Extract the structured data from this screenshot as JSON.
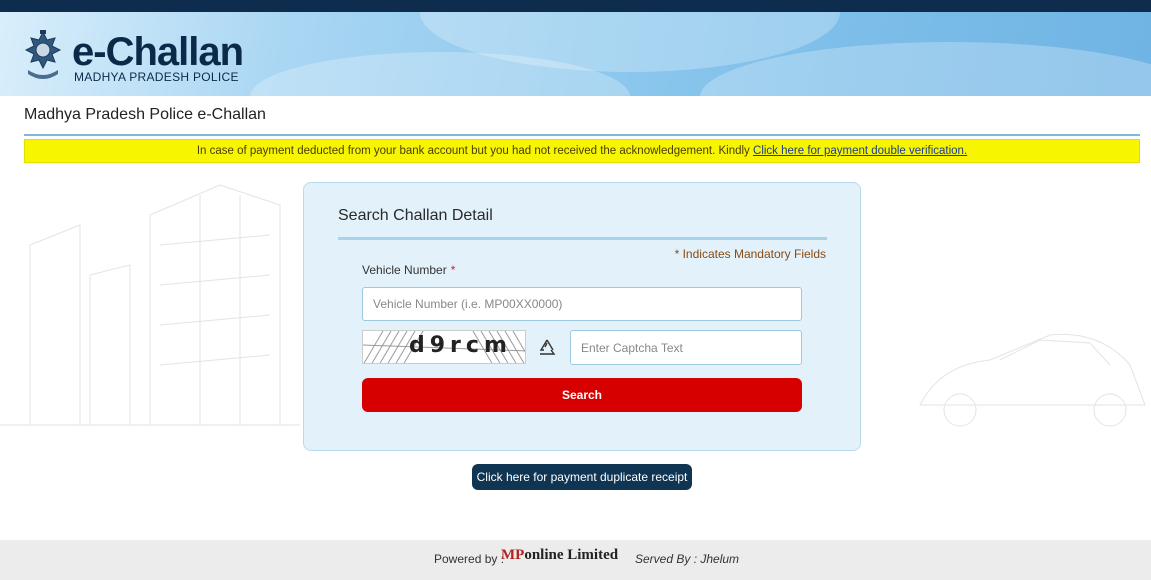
{
  "header": {
    "logo_title": "e-Challan",
    "logo_subtitle": "MADHYA PRADESH POLICE"
  },
  "page_title": "Madhya Pradesh Police e-Challan",
  "notice": {
    "text": "In case of payment deducted from your bank account but you had not received the acknowledgement. Kindly",
    "link_text": "Click here for payment double verification."
  },
  "search_form": {
    "title": "Search Challan Detail",
    "mandatory_note": "* Indicates Mandatory Fields",
    "vehicle_label": "Vehicle Number",
    "required_marker": "*",
    "vehicle_placeholder": "Vehicle Number (i.e. MP00XX0000)",
    "captcha_text": "d9rcm",
    "captcha_placeholder": "Enter Captcha Text",
    "search_label": "Search"
  },
  "duplicate_receipt_label": "Click here for payment duplicate receipt",
  "footer": {
    "powered_by": "Powered by :",
    "brand_mp": "MP",
    "brand_rest": "online Limited",
    "served_by": "Served By : Jhelum"
  },
  "colors": {
    "topbar": "#0e2d4e",
    "notice_bg": "#f7f500",
    "search_button": "#d60000",
    "duplicate_button": "#0f3553"
  }
}
